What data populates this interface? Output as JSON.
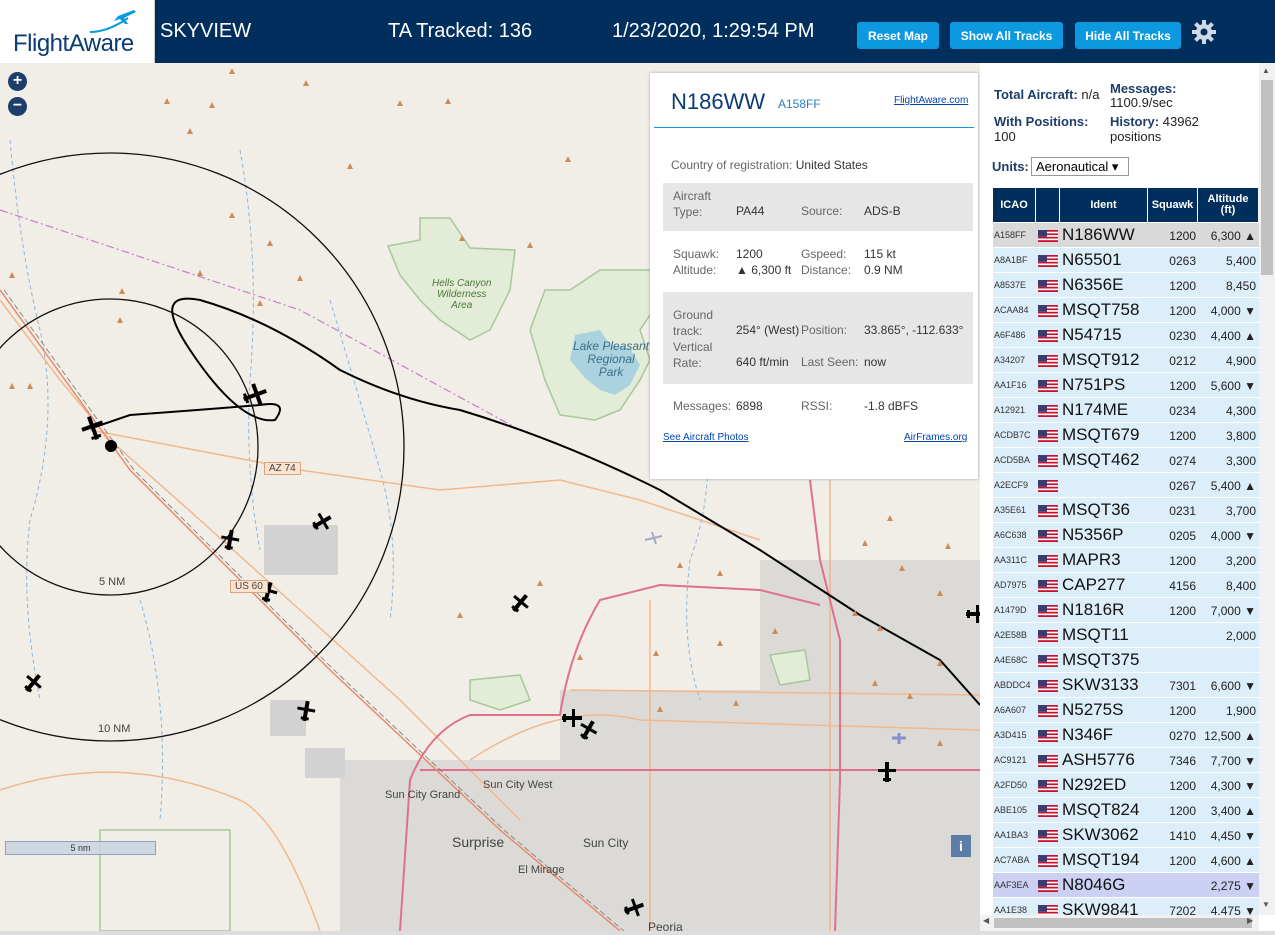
{
  "header": {
    "logo_text": "FlightAware",
    "app_name": "SKYVIEW",
    "tracked": "TA Tracked: 136",
    "datetime": "1/23/2020, 1:29:54 PM",
    "buttons": {
      "reset": "Reset Map",
      "show_all": "Show All Tracks",
      "hide_all": "Hide All Tracks"
    }
  },
  "map": {
    "zoom_in": "+",
    "zoom_out": "−",
    "scale": "5 nm",
    "info": "i",
    "range_labels": {
      "inner": "5 NM",
      "outer": "10 NM"
    },
    "places": {
      "hells_canyon": "Hells Canyon\nWilderness\nArea",
      "lake_pleasant": "Lake Pleasant\nRegional\nPark",
      "sun_city_grand": "Sun City Grand",
      "sun_city_west": "Sun City West",
      "surprise": "Surprise",
      "sun_city": "Sun City",
      "el_mirage": "El Mirage",
      "peoria": "Peoria"
    },
    "roads": {
      "az74": "AZ 74",
      "us60": "US 60"
    }
  },
  "popup": {
    "ident": "N186WW",
    "icao": "A158FF",
    "fa_link": "FlightAware.com",
    "country_label": "Country of registration:",
    "country": "United States",
    "aircraft_type_label": "Aircraft\nType:",
    "aircraft_type": "PA44",
    "source_label": "Source:",
    "source": "ADS-B",
    "squawk_label": "Squawk:",
    "squawk": "1200",
    "altitude_label": "Altitude:",
    "altitude": "▲ 6,300 ft",
    "gspeed_label": "Gspeed:",
    "gspeed": "115 kt",
    "distance_label": "Distance:",
    "distance": "0.9 NM",
    "ground_track_label": "Ground\ntrack:",
    "ground_track": "254° (West)",
    "position_label": "Position:",
    "position": "33.865°, -112.633°",
    "vrate_label": "Vertical\nRate:",
    "vrate": "640 ft/min",
    "last_seen_label": "Last Seen:",
    "last_seen": "now",
    "messages_label": "Messages:",
    "messages": "6898",
    "rssi_label": "RSSI:",
    "rssi": "-1.8 dBFS",
    "photos_link": "See Aircraft Photos",
    "airframes_link": "AirFrames.org"
  },
  "sidebar": {
    "total_aircraft_label": "Total Aircraft:",
    "total_aircraft": "n/a",
    "with_positions_label": "With Positions:",
    "with_positions": "100",
    "messages_label": "Messages:",
    "messages": "1100.9/sec",
    "history_label": "History:",
    "history": "43962",
    "history_unit": "positions",
    "units_label": "Units:",
    "units_value": "Aeronautical ▾",
    "columns": [
      "ICAO",
      "",
      "Ident",
      "Squawk",
      "Altitude\n(ft)"
    ],
    "rows": [
      {
        "icao": "A158FF",
        "ident": "N186WW",
        "squawk": "1200",
        "alt": "6,300 ▲"
      },
      {
        "icao": "A8A1BF",
        "ident": "N65501",
        "squawk": "0263",
        "alt": "5,400"
      },
      {
        "icao": "A8537E",
        "ident": "N6356E",
        "squawk": "1200",
        "alt": "8,450"
      },
      {
        "icao": "ACAA84",
        "ident": "MSQT758",
        "squawk": "1200",
        "alt": "4,000 ▼"
      },
      {
        "icao": "A6F486",
        "ident": "N54715",
        "squawk": "0230",
        "alt": "4,400 ▲"
      },
      {
        "icao": "A34207",
        "ident": "MSQT912",
        "squawk": "0212",
        "alt": "4,900"
      },
      {
        "icao": "AA1F16",
        "ident": "N751PS",
        "squawk": "1200",
        "alt": "5,600 ▼"
      },
      {
        "icao": "A12921",
        "ident": "N174ME",
        "squawk": "0234",
        "alt": "4,300"
      },
      {
        "icao": "ACDB7C",
        "ident": "MSQT679",
        "squawk": "1200",
        "alt": "3,800"
      },
      {
        "icao": "ACD5BA",
        "ident": "MSQT462",
        "squawk": "0274",
        "alt": "3,300"
      },
      {
        "icao": "A2ECF9",
        "ident": "",
        "squawk": "0267",
        "alt": "5,400 ▲"
      },
      {
        "icao": "A35E61",
        "ident": "MSQT36",
        "squawk": "0231",
        "alt": "3,700"
      },
      {
        "icao": "A6C638",
        "ident": "N5356P",
        "squawk": "0205",
        "alt": "4,000 ▼"
      },
      {
        "icao": "AA311C",
        "ident": "MAPR3",
        "squawk": "1200",
        "alt": "3,200"
      },
      {
        "icao": "AD7975",
        "ident": "CAP277",
        "squawk": "4156",
        "alt": "8,400"
      },
      {
        "icao": "A1479D",
        "ident": "N1816R",
        "squawk": "1200",
        "alt": "7,000 ▼"
      },
      {
        "icao": "A2E58B",
        "ident": "MSQT11",
        "squawk": "",
        "alt": "2,000"
      },
      {
        "icao": "A4E68C",
        "ident": "MSQT375",
        "squawk": "",
        "alt": ""
      },
      {
        "icao": "ABDDC4",
        "ident": "SKW3133",
        "squawk": "7301",
        "alt": "6,600 ▼"
      },
      {
        "icao": "A6A607",
        "ident": "N5275S",
        "squawk": "1200",
        "alt": "1,900"
      },
      {
        "icao": "A3D415",
        "ident": "N346F",
        "squawk": "0270",
        "alt": "12,500 ▲"
      },
      {
        "icao": "AC9121",
        "ident": "ASH5776",
        "squawk": "7346",
        "alt": "7,700 ▼"
      },
      {
        "icao": "A2FD50",
        "ident": "N292ED",
        "squawk": "1200",
        "alt": "4,300 ▼"
      },
      {
        "icao": "ABE105",
        "ident": "MSQT824",
        "squawk": "1200",
        "alt": "3,400 ▲"
      },
      {
        "icao": "AA1BA3",
        "ident": "SKW3062",
        "squawk": "1410",
        "alt": "4,450 ▼"
      },
      {
        "icao": "AC7ABA",
        "ident": "MSQT194",
        "squawk": "1200",
        "alt": "4,600 ▲"
      },
      {
        "icao": "AAF3EA",
        "ident": "N8046G",
        "squawk": "",
        "alt": "2,275 ▼"
      },
      {
        "icao": "AA1E38",
        "ident": "SKW9841",
        "squawk": "7202",
        "alt": "4,475 ▼"
      }
    ]
  },
  "colors": {
    "header_bg": "#002f5d",
    "button_bg": "#0d99e0",
    "row_bg": "#dbeef9",
    "selected_row": "#d9d9d9",
    "map_bg": "#f1eee8",
    "track_line": "#000000"
  }
}
